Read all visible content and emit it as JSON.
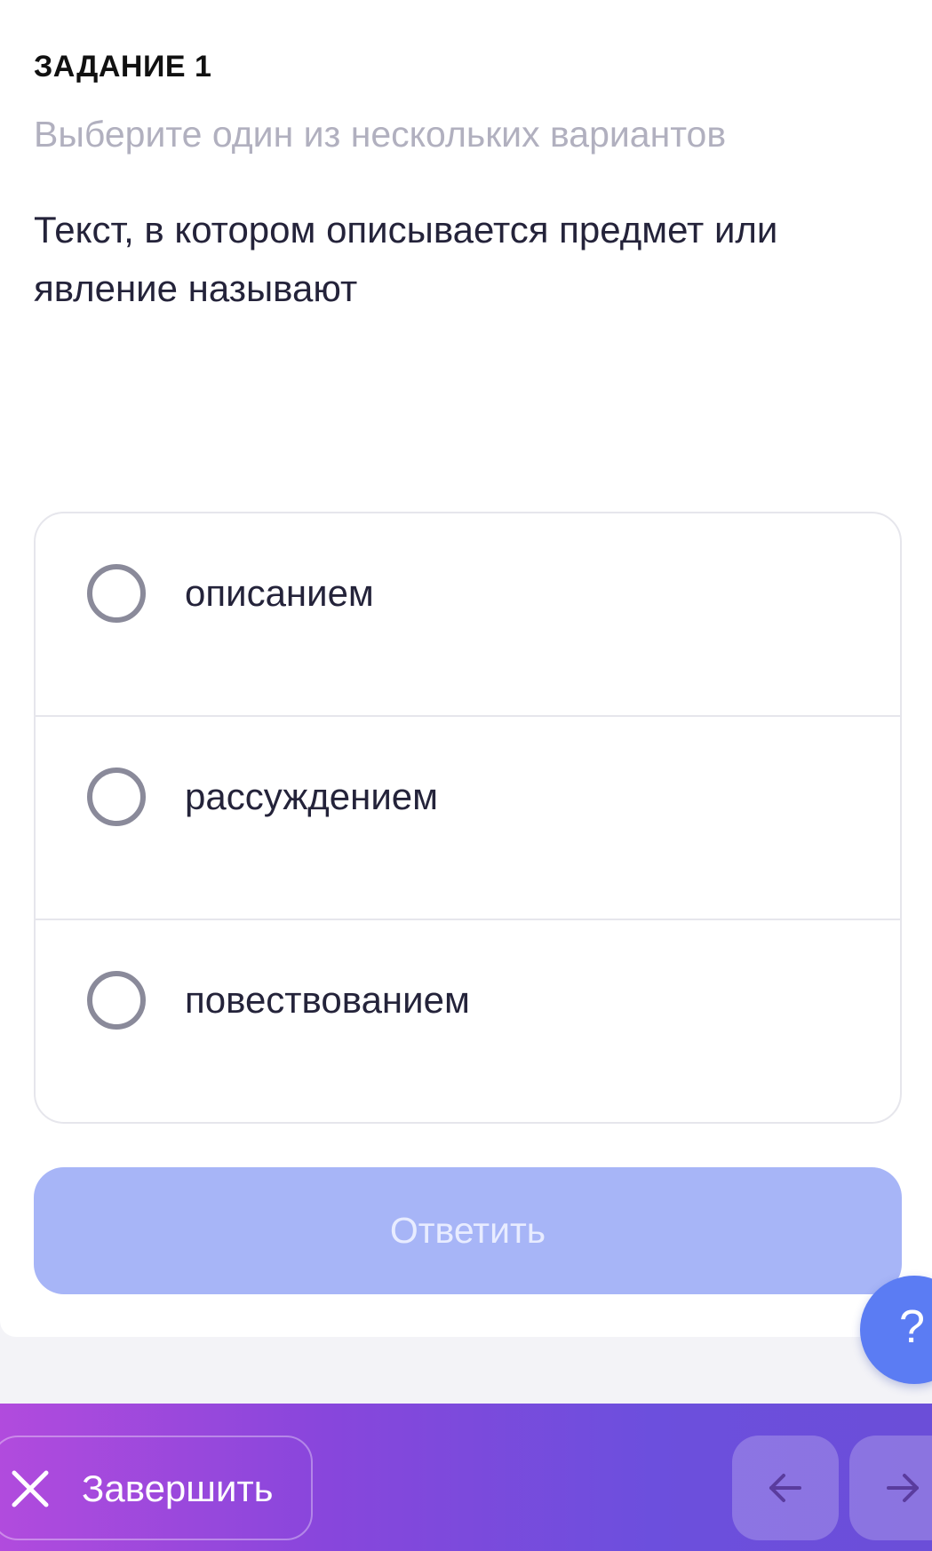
{
  "task": {
    "title": "ЗАДАНИЕ 1",
    "hint": "Выберите один из нескольких вариантов",
    "question": "Текст, в котором описывается предмет или явление называют"
  },
  "options": [
    {
      "label": "описанием",
      "selected": false
    },
    {
      "label": "рассуждением",
      "selected": false
    },
    {
      "label": "повествованием",
      "selected": false
    }
  ],
  "answer_button": {
    "label": "Ответить",
    "enabled": false
  },
  "help_button": {
    "label": "?"
  },
  "bottom_bar": {
    "finish_label": "Завершить",
    "prev_icon": "arrow-left-icon",
    "next_icon": "arrow-right-icon"
  },
  "colors": {
    "answer_button_disabled": "#a7b5f7",
    "help_button": "#5b7cf3",
    "bar_gradient_start": "#b14bdd",
    "bar_gradient_end": "#6b4ed8"
  }
}
